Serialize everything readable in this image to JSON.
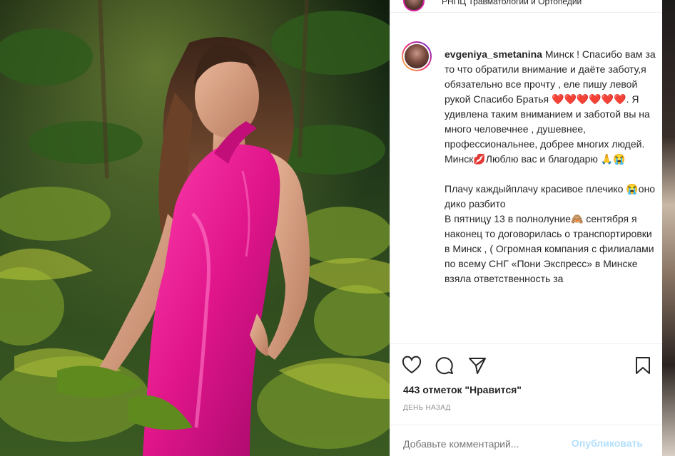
{
  "header": {
    "location": "РНПЦ Травматологии и Ортопедии"
  },
  "caption": {
    "username": "evgeniya_smetanina",
    "text": " Минск ! Спасибо вам за то что обратили внимание и даёте заботу,я обязательно все прочту , еле пишу левой рукой Спасибо Братья ❤️❤️❤️❤️❤️❤️. Я удивлена таким вниманием и заботой вы на много человечнее , душевнее, профессиональнее, добрее многих людей. Минск💋Люблю вас и благодарю 🙏😭\n\nПлачу каждыйплачу красивое плечико 😭оно дико разбито\nВ пятницу 13 в полнолуние🙈 сентября я наконец то договорилась о транспортировки в Минск , ( Огромная компания с филиалами по всему СНГ «Пони Экспресс» в Минске взяла ответственность за"
  },
  "actions": {
    "like_icon": "heart-outline-icon",
    "comment_icon": "comment-icon",
    "share_icon": "paper-plane-icon",
    "save_icon": "bookmark-icon"
  },
  "likes_text": "443 отметок \"Нравится\"",
  "timestamp": "ДЕНЬ НАЗАД",
  "comment_box": {
    "placeholder": "Добавьте комментарий...",
    "publish_label": "Опубликовать"
  },
  "colors": {
    "dress": "#e0158a",
    "accent_link": "#b2dffc",
    "secondary_text": "#8e8e8e"
  }
}
